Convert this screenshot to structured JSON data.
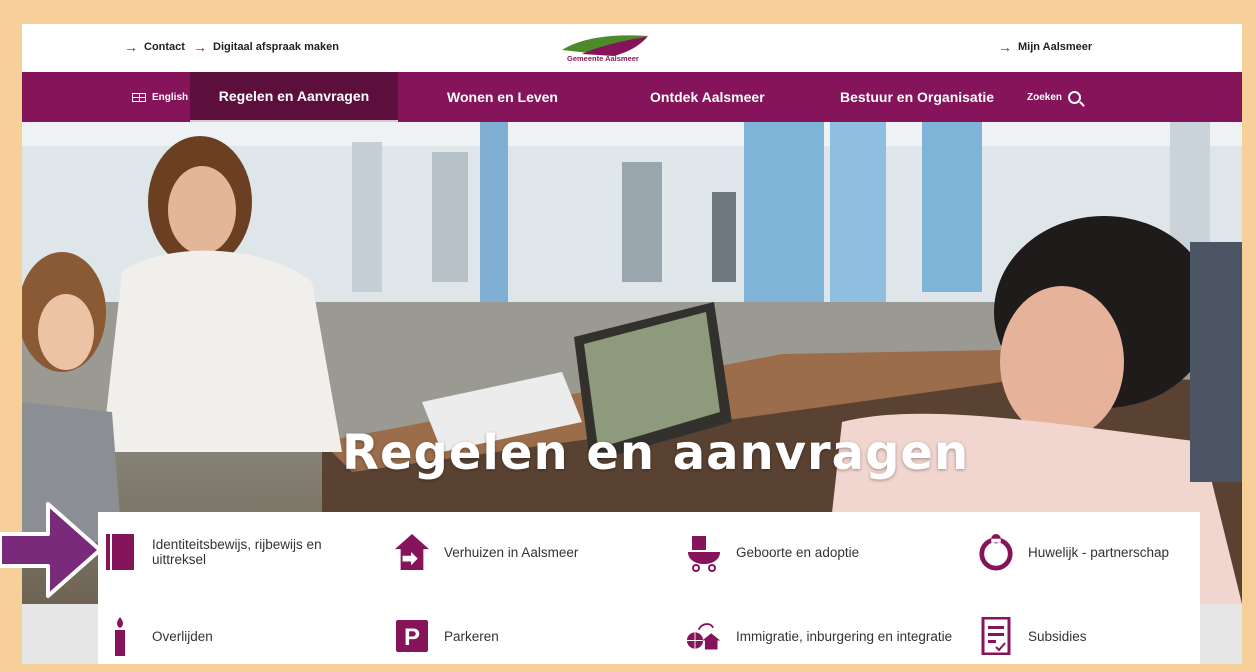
{
  "topbar": {
    "contact": "Contact",
    "appointment": "Digitaal afspraak maken",
    "logo_text": "Gemeente Aalsmeer",
    "my_account": "Mijn Aalsmeer"
  },
  "nav": {
    "language": "English",
    "items": [
      "Regelen en Aanvragen",
      "Wonen en Leven",
      "Ontdek Aalsmeer",
      "Bestuur en Organisatie"
    ],
    "search": "Zoeken"
  },
  "hero": {
    "title": "Regelen en aanvragen"
  },
  "tiles": [
    {
      "label": "Identiteitsbewijs, rijbewijs en uittreksel",
      "icon": "passport-icon"
    },
    {
      "label": "Verhuizen in Aalsmeer",
      "icon": "moving-house-icon"
    },
    {
      "label": "Geboorte en adoptie",
      "icon": "stroller-icon"
    },
    {
      "label": "Huwelijk - partnerschap",
      "icon": "ring-icon"
    },
    {
      "label": "Overlijden",
      "icon": "candle-icon"
    },
    {
      "label": "Parkeren",
      "icon": "parking-icon"
    },
    {
      "label": "Immigratie, inburgering en integratie",
      "icon": "globe-house-icon"
    },
    {
      "label": "Subsidies",
      "icon": "checklist-icon"
    }
  ],
  "colors": {
    "brand": "#85145a",
    "brand_dark": "#5c0f3c",
    "frame": "#f7cf98",
    "pointer": "#7a2a7a"
  }
}
